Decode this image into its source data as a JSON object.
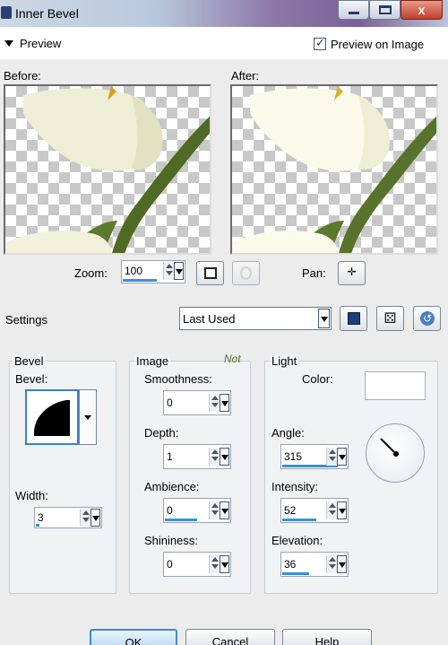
{
  "window": {
    "title": "Inner Bevel",
    "close_glyph": "x"
  },
  "preview": {
    "label": "Preview",
    "preview_on_image_label": "Preview on Image",
    "preview_on_image_checked": true,
    "before_label": "Before:",
    "after_label": "After:"
  },
  "zoom": {
    "label": "Zoom:",
    "value": "100",
    "pan_label": "Pan:"
  },
  "settings": {
    "label": "Settings",
    "preset": "Last Used"
  },
  "bevel": {
    "group_title": "Bevel",
    "bevel_label": "Bevel:",
    "width_label": "Width:",
    "width_value": "3"
  },
  "image": {
    "group_title": "Image",
    "watermark": "Not",
    "smoothness_label": "Smoothness:",
    "smoothness_value": "0",
    "depth_label": "Depth:",
    "depth_value": "1",
    "ambience_label": "Ambience:",
    "ambience_value": "0",
    "shininess_label": "Shininess:",
    "shininess_value": "0"
  },
  "light": {
    "group_title": "Light",
    "color_label": "Color:",
    "color_value": "#ffffff",
    "angle_label": "Angle:",
    "angle_value": "315",
    "intensity_label": "Intensity:",
    "intensity_value": "52",
    "elevation_label": "Elevation:",
    "elevation_value": "36"
  },
  "footer": {
    "ok": "OK",
    "cancel": "Cancel",
    "help": "Help"
  },
  "icons": [
    "app-icon",
    "minimize-icon",
    "maximize-icon",
    "close-icon",
    "collapse-arrow-icon",
    "zoom-to-fit-icon",
    "proof-icon",
    "pan-icon",
    "save-preset-icon",
    "randomize-dice-icon",
    "reset-icon"
  ],
  "colors": {
    "accent": "#3a8fdd",
    "title_gradient_mid": "#7a5f98",
    "close_button": "#c0402c"
  }
}
